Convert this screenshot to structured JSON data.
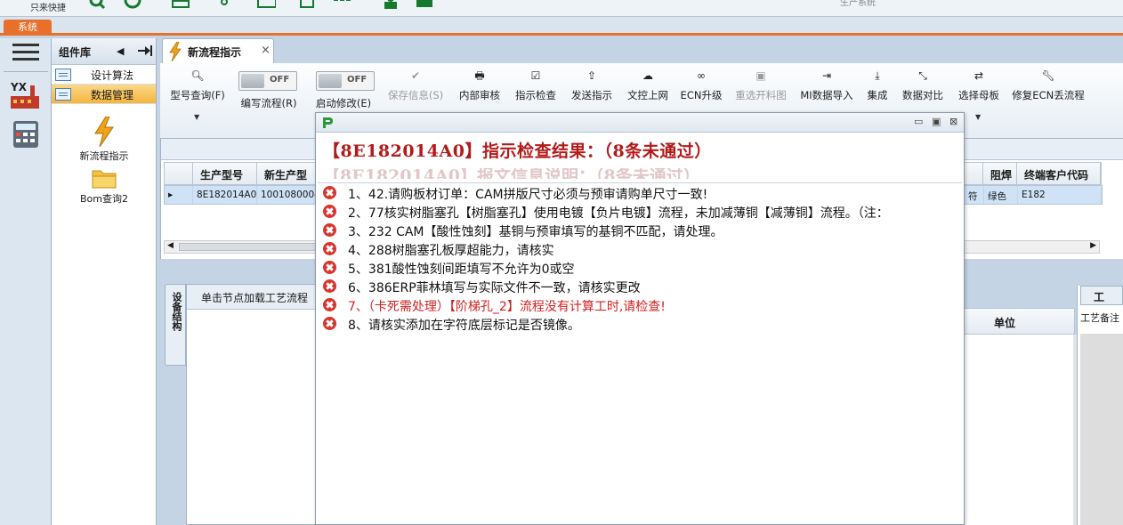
{
  "topbar": {
    "quick_label": "只来快捷",
    "window_title": "生产系统"
  },
  "system_tab": "系统",
  "component_panel": {
    "title": "组件库",
    "categories": [
      {
        "label": "设计算法",
        "selected": false
      },
      {
        "label": "数据管理",
        "selected": true
      }
    ],
    "tools": [
      {
        "label": "新流程指示"
      },
      {
        "label": "Bom查询2"
      }
    ]
  },
  "main_tab": {
    "label": "新流程指示",
    "close": "×"
  },
  "ribbon": {
    "model_query": "型号查询(F)",
    "write_flow": "编写流程(R)",
    "start_modify": "启动修改(E)",
    "toggle_off": "OFF",
    "buttons": [
      {
        "label": "保存信息(S)",
        "disabled": true
      },
      {
        "label": "内部审核",
        "disabled": false
      },
      {
        "label": "指示检查",
        "disabled": false
      },
      {
        "label": "发送指示",
        "disabled": false
      },
      {
        "label": "文控上网",
        "disabled": false
      },
      {
        "label": "ECN升级",
        "disabled": false
      },
      {
        "label": "重选开料图",
        "disabled": true
      },
      {
        "label": "MI数据导入",
        "disabled": false
      },
      {
        "label": "集成",
        "disabled": false
      },
      {
        "label": "数据对比",
        "disabled": false
      },
      {
        "label": "选择母板",
        "disabled": false
      },
      {
        "label": "修复ECN丢流程",
        "disabled": false
      }
    ]
  },
  "grid": {
    "columns_left": [
      "生产型号",
      "新生产型"
    ],
    "columns_right": [
      "阻焊",
      "终端客户代码"
    ],
    "row_left": [
      "8E182014A0",
      "10010800045"
    ],
    "row_right": [
      "符",
      "绿色",
      "E182"
    ],
    "row_indicator": "▸"
  },
  "lower": {
    "side_tab": "设备结构",
    "tree_hint": "单击节点加载工艺流程",
    "unit_header": "单位",
    "right_tab": "工",
    "right_note": "工艺备注"
  },
  "dialog": {
    "header": "【8E182014A0】指示检查结果：（8条未通过）",
    "ghost_header": "【8E182014A0】报文信息说明：（8条未通过）",
    "items": [
      {
        "text": "1、42.请购板材订单：CAM拼版尺寸必须与预审请购单尺寸一致!",
        "highlight": false
      },
      {
        "text": "2、77核实树脂塞孔【树脂塞孔】使用电镀【负片电镀】流程，未加减薄铜【减薄铜】流程。（注：",
        "highlight": false
      },
      {
        "text": "3、232 CAM【酸性蚀刻】基铜与预审填写的基铜不匹配，请处理。",
        "highlight": false
      },
      {
        "text": "4、288树脂塞孔板厚超能力，请核实",
        "highlight": false
      },
      {
        "text": "5、381酸性蚀刻间距填写不允许为0或空",
        "highlight": false
      },
      {
        "text": "6、386ERP菲林填写与实际文件不一致，请核实更改",
        "highlight": false
      },
      {
        "text": "7、（卡死需处理）【阶梯孔_2】流程没有计算工时,请检查!",
        "highlight": true
      },
      {
        "text": "8、请核实添加在字符底层标记是否镜像。",
        "highlight": false
      }
    ]
  }
}
